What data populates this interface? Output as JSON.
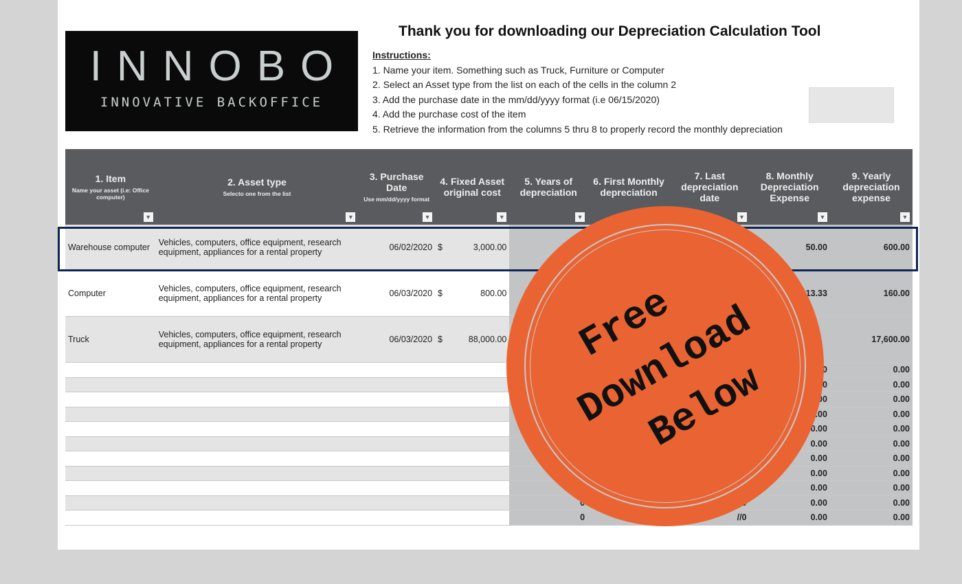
{
  "logo": {
    "name": "INNOBO",
    "tagline": "INNOVATIVE BACKOFFICE"
  },
  "title": "Thank you for downloading our Depreciation Calculation Tool",
  "instructions": {
    "heading": "Instructions:",
    "steps": [
      "1. Name your item. Something such as Truck, Furniture or Computer",
      "2. Select an Asset type from the list on each of the cells in the column 2",
      "3. Add the purchase date in the mm/dd/yyyy format (i.e 06/15/2020)",
      "4. Add the purchase cost of the item",
      "5. Retrieve the information from the columns 5 thru 8 to properly record the monthly depreciation"
    ]
  },
  "columns": [
    {
      "label": "1. Item",
      "sub": "Name your asset (i.e: Office computer)"
    },
    {
      "label": "2. Asset type",
      "sub": "Selecto one from the list"
    },
    {
      "label": "3. Purchase Date",
      "sub": "Use mm/dd/yyyy format"
    },
    {
      "label": "4. Fixed Asset original cost",
      "sub": ""
    },
    {
      "label": "5. Years of depreciation",
      "sub": ""
    },
    {
      "label": "6. First Monthly depreciation",
      "sub": ""
    },
    {
      "label": "7. Last depreciation date",
      "sub": ""
    },
    {
      "label": "8. Monthly Depreciation Expense",
      "sub": ""
    },
    {
      "label": "9. Yearly depreciation expense",
      "sub": ""
    }
  ],
  "rows": [
    {
      "item": "Warehouse computer",
      "type": "Vehicles, computers, office equipment, research equipment, appliances for a rental property",
      "date": "06/02/2020",
      "cur": "$",
      "cost": "3,000.00",
      "monthly": "50.00",
      "yearly": "600.00"
    },
    {
      "item": "Computer",
      "type": "Vehicles, computers, office equipment, research equipment, appliances for a rental property",
      "date": "06/03/2020",
      "cur": "$",
      "cost": "800.00",
      "monthly": "13.33",
      "yearly": "160.00"
    },
    {
      "item": "Truck",
      "type": "Vehicles, computers, office equipment, research equipment, appliances for a rental property",
      "date": "06/03/2020",
      "cur": "$",
      "cost": "88,000.00",
      "monthly": "",
      "yearly": "17,600.00"
    }
  ],
  "empty_row": {
    "years": "0",
    "last": "//0",
    "monthly": "0.00",
    "yearly": "0.00"
  },
  "stamp": {
    "lines": [
      "Free",
      "Download",
      "Below"
    ],
    "color": "#ea6433"
  }
}
